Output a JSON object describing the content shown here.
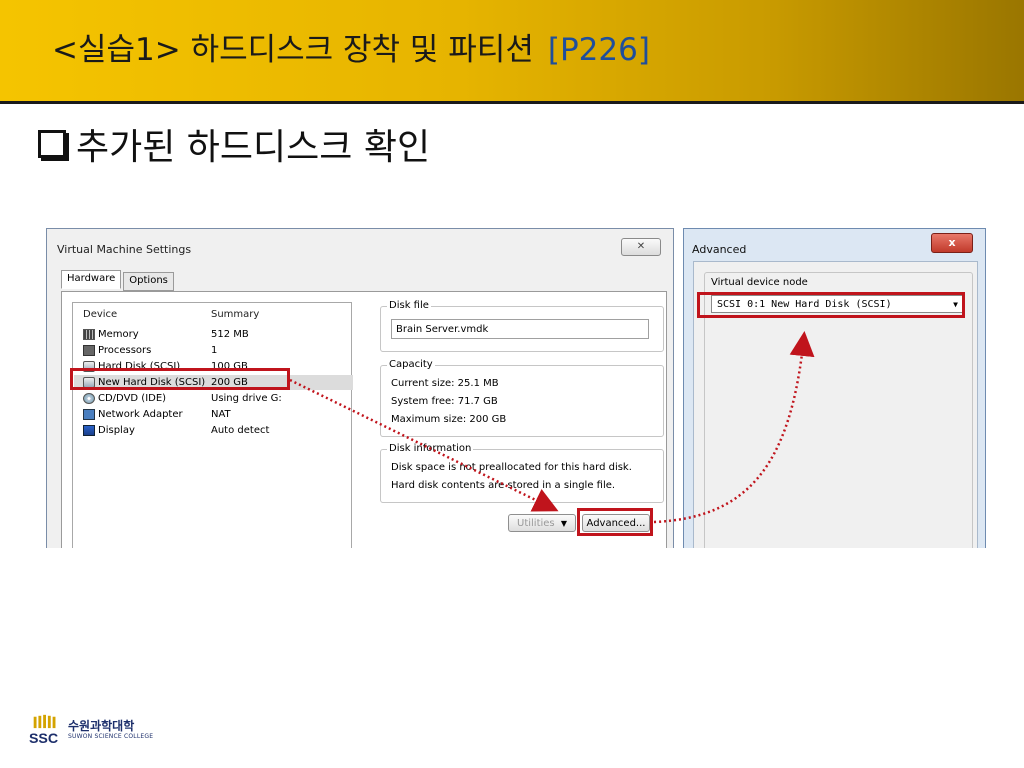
{
  "slide": {
    "title": "<실습1> 하드디스크 장착 및 파티션",
    "title_ref": "[P226]",
    "subtitle": "추가된 하드디스크 확인"
  },
  "vm_settings": {
    "window_title": "Virtual Machine Settings",
    "close_glyph": "✕",
    "tabs": [
      {
        "label": "Hardware",
        "active": true
      },
      {
        "label": "Options",
        "active": false
      }
    ],
    "columns": [
      "Device",
      "Summary"
    ],
    "devices": [
      {
        "name": "Memory",
        "summary": "512 MB",
        "icon": "memory-icon"
      },
      {
        "name": "Processors",
        "summary": "1",
        "icon": "processor-icon"
      },
      {
        "name": "Hard Disk (SCSI)",
        "summary": "100 GB",
        "icon": "hard-disk-icon"
      },
      {
        "name": "New Hard Disk (SCSI)",
        "summary": "200 GB",
        "icon": "hard-disk-icon",
        "selected": true
      },
      {
        "name": "CD/DVD (IDE)",
        "summary": "Using drive G:",
        "icon": "cd-dvd-icon"
      },
      {
        "name": "Network Adapter",
        "summary": "NAT",
        "icon": "network-adapter-icon"
      },
      {
        "name": "Display",
        "summary": "Auto detect",
        "icon": "display-icon"
      }
    ],
    "disk_file": {
      "label": "Disk file",
      "value": "Brain Server.vmdk"
    },
    "capacity": {
      "label": "Capacity",
      "current": "Current size: 25.1 MB",
      "free": "System free: 71.7 GB",
      "maximum": "Maximum size: 200 GB"
    },
    "disk_information": {
      "label": "Disk information",
      "line1": "Disk space is not preallocated for this hard disk.",
      "line2": "Hard disk contents are stored in a single file."
    },
    "buttons": {
      "utilities": "Utilities",
      "advanced": "Advanced..."
    }
  },
  "advanced": {
    "window_title": "Advanced",
    "close_glyph": "x",
    "group_label": "Virtual device node",
    "selected_node": "SCSI 0:1  New Hard Disk (SCSI)"
  },
  "logo": {
    "korean": "수원과학대학",
    "english": "SUWON SCIENCE COLLEGE",
    "mark": "SSC"
  },
  "colors": {
    "header_start": "#f5c400",
    "header_end": "#9a7600",
    "highlight_red": "#c0141c",
    "title_ref_blue": "#1f4e9c"
  }
}
